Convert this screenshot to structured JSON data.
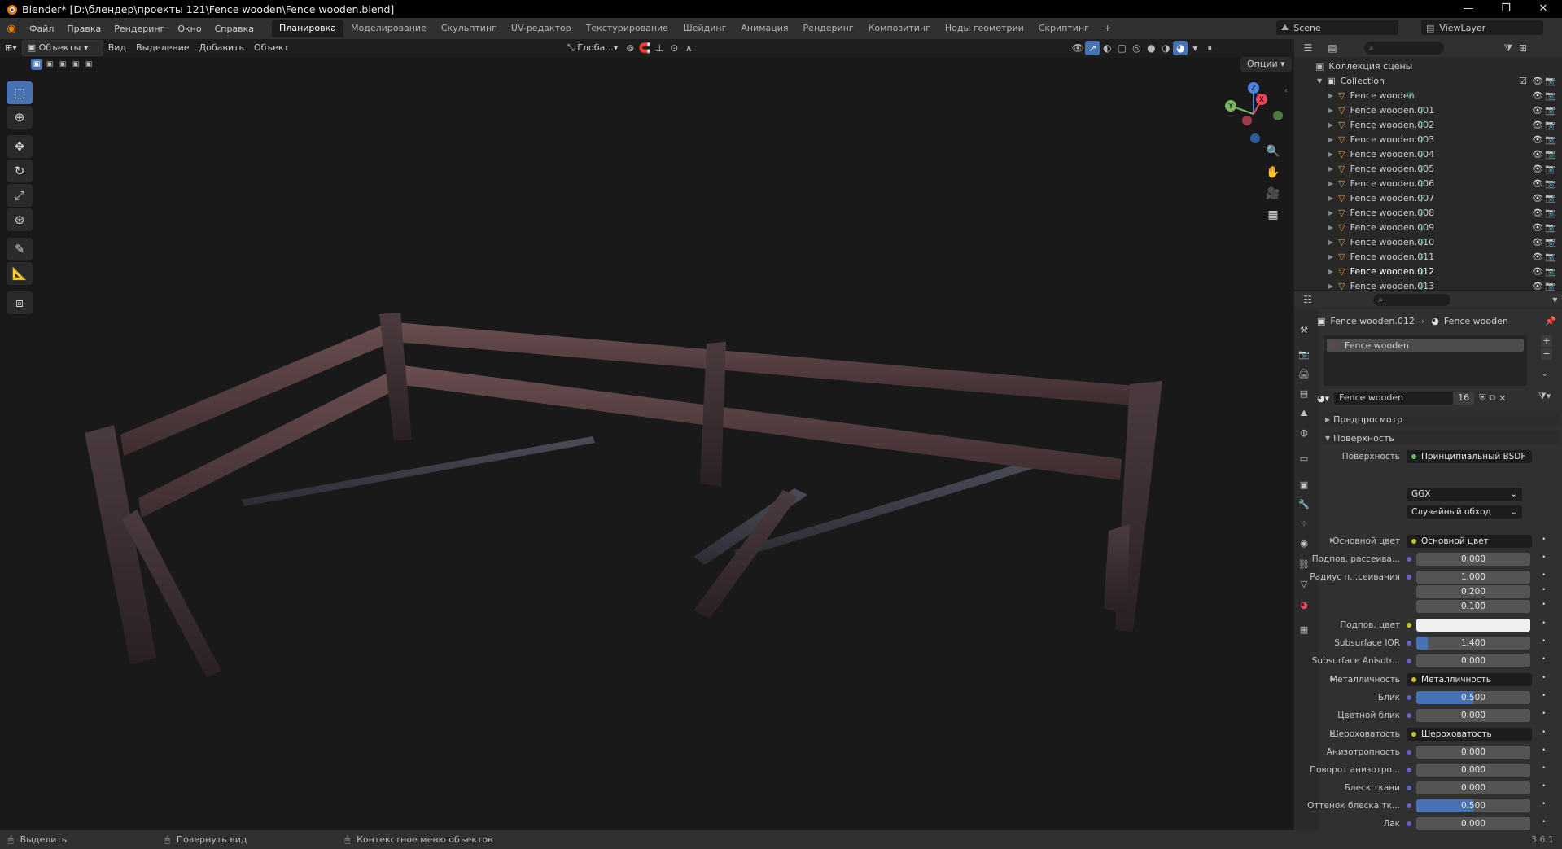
{
  "window": {
    "title": "Blender* [D:\\блендер\\проекты 121\\Fence wooden\\Fence wooden.blend]",
    "minimize": "—",
    "maximize": "❐",
    "close": "✕"
  },
  "menubar": {
    "menus": [
      "Файл",
      "Правка",
      "Рендеринг",
      "Окно",
      "Справка"
    ],
    "workspaces": [
      "Планировка",
      "Моделирование",
      "Скульптинг",
      "UV-редактор",
      "Текстурирование",
      "Шейдинг",
      "Анимация",
      "Рендеринг",
      "Композитинг",
      "Ноды геометрии",
      "Скриптинг"
    ],
    "active_workspace": "Планировка",
    "add_tab": "+",
    "scene_name": "Scene",
    "view_layer": "ViewLayer"
  },
  "viewport_header": {
    "mode": "Объекты",
    "menus": [
      "Вид",
      "Выделение",
      "Добавить",
      "Объект"
    ],
    "orientation": "Глоба...",
    "options_label": "Опции"
  },
  "toolbar": {
    "tools": [
      "select-box",
      "cursor",
      "move",
      "rotate",
      "scale",
      "transform",
      "annotate",
      "measure",
      "add-cube"
    ]
  },
  "outliner": {
    "root_label": "Коллекция сцены",
    "collection": "Collection",
    "objects": [
      "Fence wooden",
      "Fence wooden.001",
      "Fence wooden.002",
      "Fence wooden.003",
      "Fence wooden.004",
      "Fence wooden.005",
      "Fence wooden.006",
      "Fence wooden.007",
      "Fence wooden.008",
      "Fence wooden.009",
      "Fence wooden.010",
      "Fence wooden.011",
      "Fence wooden.012",
      "Fence wooden.013"
    ]
  },
  "properties": {
    "breadcrumb_object": "Fence wooden.012",
    "breadcrumb_material": "Fence wooden",
    "slot_material": "Fence wooden",
    "material_name": "Fence wooden",
    "user_count": "16",
    "preview_label": "Предпросмотр",
    "surface_panel_label": "Поверхность",
    "surface_label": "Поверхность",
    "surface_value": "Принципиальный BSDF",
    "distribution": "GGX",
    "subsurface_method": "Случайный обход",
    "rows": [
      {
        "label": "Основной цвет",
        "value": "Основной цвет",
        "kind": "link"
      },
      {
        "label": "Подпов. рассеива...",
        "value": "0.000",
        "kind": "num"
      },
      {
        "label": "Радиус п...сеивания",
        "value": "1.000",
        "kind": "num"
      },
      {
        "label": "",
        "value": "0.200",
        "kind": "num"
      },
      {
        "label": "",
        "value": "0.100",
        "kind": "num"
      },
      {
        "label": "Подпов. цвет",
        "value": "",
        "kind": "color"
      },
      {
        "label": "Subsurface IOR",
        "value": "1.400",
        "kind": "num",
        "fill": 0.1
      },
      {
        "label": "Subsurface Anisotr...",
        "value": "0.000",
        "kind": "num"
      },
      {
        "label": "Металличность",
        "value": "Металличность",
        "kind": "link"
      },
      {
        "label": "Блик",
        "value": "0.500",
        "kind": "num",
        "fill": 0.5
      },
      {
        "label": "Цветной блик",
        "value": "0.000",
        "kind": "num"
      },
      {
        "label": "Шероховатость",
        "value": "Шероховатость",
        "kind": "link"
      },
      {
        "label": "Анизотропность",
        "value": "0.000",
        "kind": "num"
      },
      {
        "label": "Поворот анизотро...",
        "value": "0.000",
        "kind": "num"
      },
      {
        "label": "Блеск ткани",
        "value": "0.000",
        "kind": "num"
      },
      {
        "label": "Оттенок блеска тк...",
        "value": "0.500",
        "kind": "num",
        "fill": 0.5
      },
      {
        "label": "Лак",
        "value": "0.000",
        "kind": "num"
      }
    ]
  },
  "statusbar": {
    "select": "Выделить",
    "rotate_view": "Повернуть вид",
    "context_menu": "Контекстное меню объектов",
    "version": "3.6.1"
  }
}
